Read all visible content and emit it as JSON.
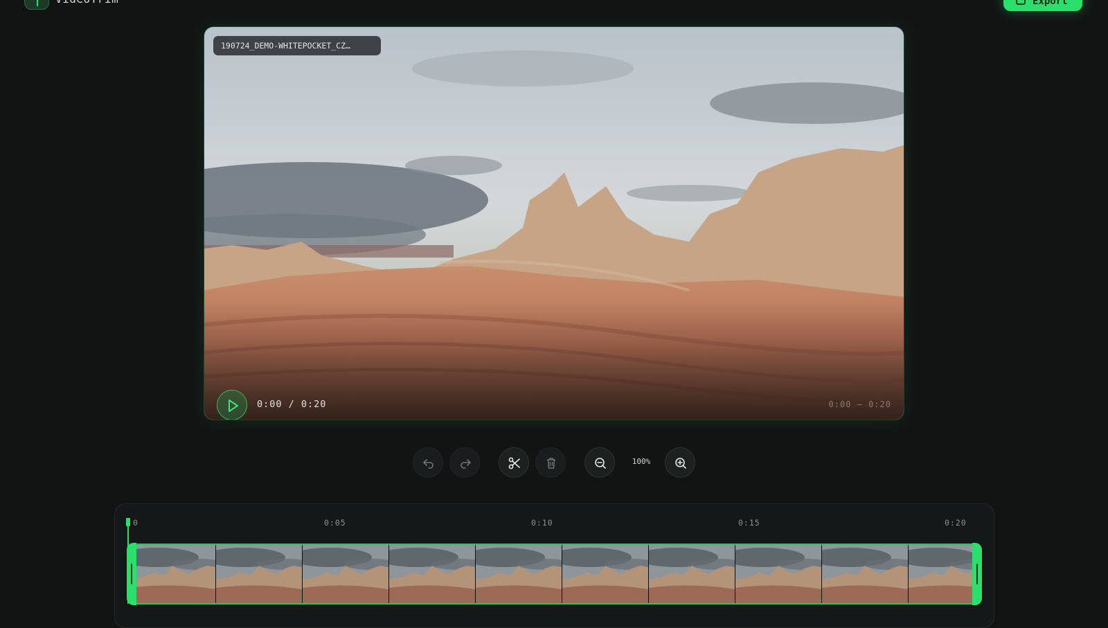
{
  "app": {
    "name": "VideoTrim",
    "export_label": "Export"
  },
  "player": {
    "file_name": "190724_DEMO-WHITEPOCKET_CZ…",
    "current_time": "0:00",
    "duration": "0:20",
    "time_display": "0:00 / 0:20",
    "range_display": "0:00 – 0:20",
    "progress": 0
  },
  "toolbar": {
    "zoom_level": "100%",
    "icons": [
      "undo-icon",
      "redo-icon",
      "scissors-icon",
      "trash-icon",
      "zoom-out-icon",
      "zoom-in-icon"
    ]
  },
  "timeline": {
    "ticks": [
      "0",
      "0:05",
      "0:10",
      "0:15",
      "0:20"
    ],
    "trim_start": "0:00",
    "trim_end": "0:20",
    "frame_count": 10
  },
  "colors": {
    "accent": "#2be06a",
    "background": "#121414",
    "panel": "#151818"
  }
}
